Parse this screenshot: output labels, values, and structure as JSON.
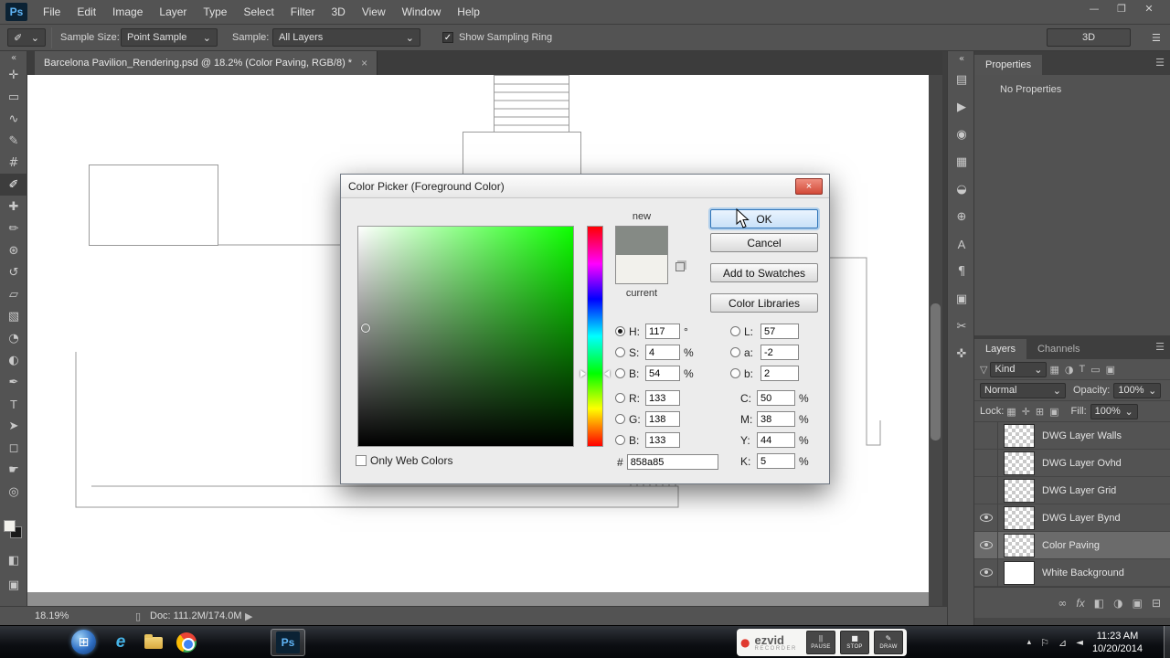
{
  "app": {
    "logo": "Ps"
  },
  "window_controls": {
    "minimize": "—",
    "restore": "❐",
    "close": "✕"
  },
  "ui": {
    "chevron": "⌄",
    "menu": "☰",
    "collapse": "«",
    "check": "✓"
  },
  "menubar": {
    "items": [
      "File",
      "Edit",
      "Image",
      "Layer",
      "Type",
      "Select",
      "Filter",
      "3D",
      "View",
      "Window",
      "Help"
    ]
  },
  "options_bar": {
    "tool_icon_glyph": "✐",
    "sample_size_label": "Sample Size:",
    "sample_size_value": "Point Sample",
    "sample_label": "Sample:",
    "sample_value": "All Layers",
    "show_sampling_ring_label": "Show Sampling Ring",
    "workspace_label": "3D"
  },
  "document_tab": {
    "title": "Barcelona Pavilion_Rendering.psd @ 18.2% (Color Paving, RGB/8) *",
    "close_glyph": "×"
  },
  "tools": [
    {
      "name": "move-tool",
      "glyph": "✛"
    },
    {
      "name": "marquee-tool",
      "glyph": "▭"
    },
    {
      "name": "lasso-tool",
      "glyph": "∿"
    },
    {
      "name": "quick-selection-tool",
      "glyph": "✎"
    },
    {
      "name": "crop-tool",
      "glyph": "#"
    },
    {
      "name": "eyedropper-tool",
      "glyph": "✐"
    },
    {
      "name": "healing-brush-tool",
      "glyph": "✚"
    },
    {
      "name": "brush-tool",
      "glyph": "✏"
    },
    {
      "name": "clone-stamp-tool",
      "glyph": "⊛"
    },
    {
      "name": "history-brush-tool",
      "glyph": "↺"
    },
    {
      "name": "eraser-tool",
      "glyph": "▱"
    },
    {
      "name": "gradient-tool",
      "glyph": "▧"
    },
    {
      "name": "blur-tool",
      "glyph": "◔"
    },
    {
      "name": "dodge-tool",
      "glyph": "◐"
    },
    {
      "name": "pen-tool",
      "glyph": "✒"
    },
    {
      "name": "type-tool",
      "glyph": "T"
    },
    {
      "name": "path-selection-tool",
      "glyph": "➤"
    },
    {
      "name": "shape-tool",
      "glyph": "◻"
    },
    {
      "name": "hand-tool",
      "glyph": "☛"
    },
    {
      "name": "zoom-tool",
      "glyph": "◎"
    }
  ],
  "tool_colors": {
    "foreground": "#f2f1ec",
    "background": "#1a1a1a"
  },
  "toolbar_extra": {
    "quick_mask_glyph": "◧",
    "screen_mode_glyph": "▣"
  },
  "right_rail": {
    "icons": [
      {
        "name": "history-icon",
        "glyph": "▤"
      },
      {
        "name": "actions-icon",
        "glyph": "▶"
      },
      {
        "name": "info-icon",
        "glyph": "◉"
      },
      {
        "name": "histogram-icon",
        "glyph": "▦"
      },
      {
        "name": "navigator-icon",
        "glyph": "◒"
      },
      {
        "name": "clone-source-icon",
        "glyph": "⊕"
      },
      {
        "name": "character-icon",
        "glyph": "A"
      },
      {
        "name": "paragraph-icon",
        "glyph": "¶"
      },
      {
        "name": "timeline-icon",
        "glyph": "▣"
      },
      {
        "name": "notes-icon",
        "glyph": "✂"
      },
      {
        "name": "measure-icon",
        "glyph": "✜"
      }
    ]
  },
  "properties_panel": {
    "tab_label": "Properties",
    "empty_text": "No Properties"
  },
  "layers_panel": {
    "tab_layers": "Layers",
    "tab_channels": "Channels",
    "filter_funnel_glyph": "▽",
    "filter_label": "Kind",
    "filter_icons": [
      "▦",
      "◑",
      "T",
      "▭",
      "▣"
    ],
    "blend_mode": "Normal",
    "opacity_label": "Opacity:",
    "opacity_value": "100%",
    "lock_label": "Lock:",
    "lock_icons": [
      "▦",
      "✛",
      "⊞",
      "▣"
    ],
    "fill_label": "Fill:",
    "fill_value": "100%",
    "layers": [
      {
        "name": "DWG Layer Walls"
      },
      {
        "name": "DWG Layer Ovhd"
      },
      {
        "name": "DWG Layer Grid"
      },
      {
        "name": "DWG Layer Bynd"
      },
      {
        "name": "Color Paving"
      },
      {
        "name": "White Background"
      }
    ],
    "bottom_icons": [
      {
        "name": "link-layers-icon",
        "glyph": "∞"
      },
      {
        "name": "layer-effects-icon",
        "glyph": "fx"
      },
      {
        "name": "layer-mask-icon",
        "glyph": "◧"
      },
      {
        "name": "adjustment-layer-icon",
        "glyph": "◑"
      },
      {
        "name": "new-group-icon",
        "glyph": "▣"
      },
      {
        "name": "delete-layer-icon",
        "glyph": "⊟"
      }
    ]
  },
  "color_picker": {
    "title": "Color Picker (Foreground Color)",
    "close_glyph": "×",
    "new_label": "new",
    "current_label": "current",
    "new_color": "#858a85",
    "current_color": "#f2f1ec",
    "ok_label": "OK",
    "cancel_label": "Cancel",
    "add_to_swatches_label": "Add to Swatches",
    "color_libraries_label": "Color Libraries",
    "hsb": {
      "h": {
        "label": "H:",
        "value": "117",
        "unit": "°"
      },
      "s": {
        "label": "S:",
        "value": "4",
        "unit": "%"
      },
      "b": {
        "label": "B:",
        "value": "54",
        "unit": "%"
      }
    },
    "rgb": {
      "r": {
        "label": "R:",
        "value": "133"
      },
      "g": {
        "label": "G:",
        "value": "138"
      },
      "b": {
        "label": "B:",
        "value": "133"
      }
    },
    "lab": {
      "l": {
        "label": "L:",
        "value": "57"
      },
      "a": {
        "label": "a:",
        "value": "-2"
      },
      "b": {
        "label": "b:",
        "value": "2"
      }
    },
    "cmyk": {
      "c": {
        "label": "C:",
        "value": "50",
        "unit": "%"
      },
      "m": {
        "label": "M:",
        "value": "38",
        "unit": "%"
      },
      "y": {
        "label": "Y:",
        "value": "44",
        "unit": "%"
      },
      "k": {
        "label": "K:",
        "value": "5",
        "unit": "%"
      }
    },
    "hex_label": "#",
    "hex_value": "858a85",
    "only_web_colors_label": "Only Web Colors"
  },
  "status_bar": {
    "zoom": "18.19%",
    "doc_icon_glyph": "▯",
    "doc_info": "Doc: 111.2M/174.0M",
    "play_glyph": "▶"
  },
  "taskbar": {
    "start_glyph": "⊞",
    "ie_glyph": "e",
    "recorder": {
      "dot_glyph": "●",
      "brand": "ezvid",
      "sub": "RECORDER",
      "pause_glyph": "||",
      "pause_label": "PAUSE",
      "stop_glyph": "■",
      "stop_label": "STOP",
      "draw_glyph": "✎",
      "draw_label": "DRAW"
    },
    "tray_icons": [
      {
        "name": "show-hidden-icons-icon",
        "glyph": "▴"
      },
      {
        "name": "action-center-icon",
        "glyph": "⚐"
      },
      {
        "name": "network-icon",
        "glyph": "⊿"
      },
      {
        "name": "volume-icon",
        "glyph": "◄"
      }
    ],
    "time": "11:23 AM",
    "date": "10/20/2014"
  }
}
